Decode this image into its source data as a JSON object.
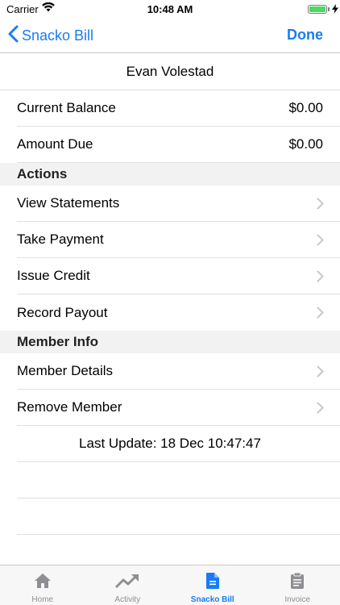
{
  "status": {
    "carrier": "Carrier",
    "time": "10:48 AM"
  },
  "nav": {
    "back_label": "Snacko Bill",
    "done_label": "Done"
  },
  "member": {
    "name": "Evan Volestad"
  },
  "balances": [
    {
      "label": "Current Balance",
      "value": "$0.00"
    },
    {
      "label": "Amount Due",
      "value": "$0.00"
    }
  ],
  "sections": {
    "actions": {
      "title": "Actions",
      "items": [
        "View Statements",
        "Take Payment",
        "Issue Credit",
        "Record Payout"
      ]
    },
    "member_info": {
      "title": "Member Info",
      "items": [
        "Member Details",
        "Remove Member"
      ]
    }
  },
  "footer": {
    "last_update": "Last Update: 18 Dec 10:47:47"
  },
  "tabs": [
    {
      "label": "Home",
      "icon": "home-icon"
    },
    {
      "label": "Activity",
      "icon": "trend-icon"
    },
    {
      "label": "Snacko Bill",
      "icon": "document-icon",
      "active": true
    },
    {
      "label": "Invoice",
      "icon": "clipboard-icon"
    }
  ],
  "colors": {
    "accent": "#1a7cf5",
    "battery": "#4cd964",
    "inactive": "#8e8e93"
  }
}
